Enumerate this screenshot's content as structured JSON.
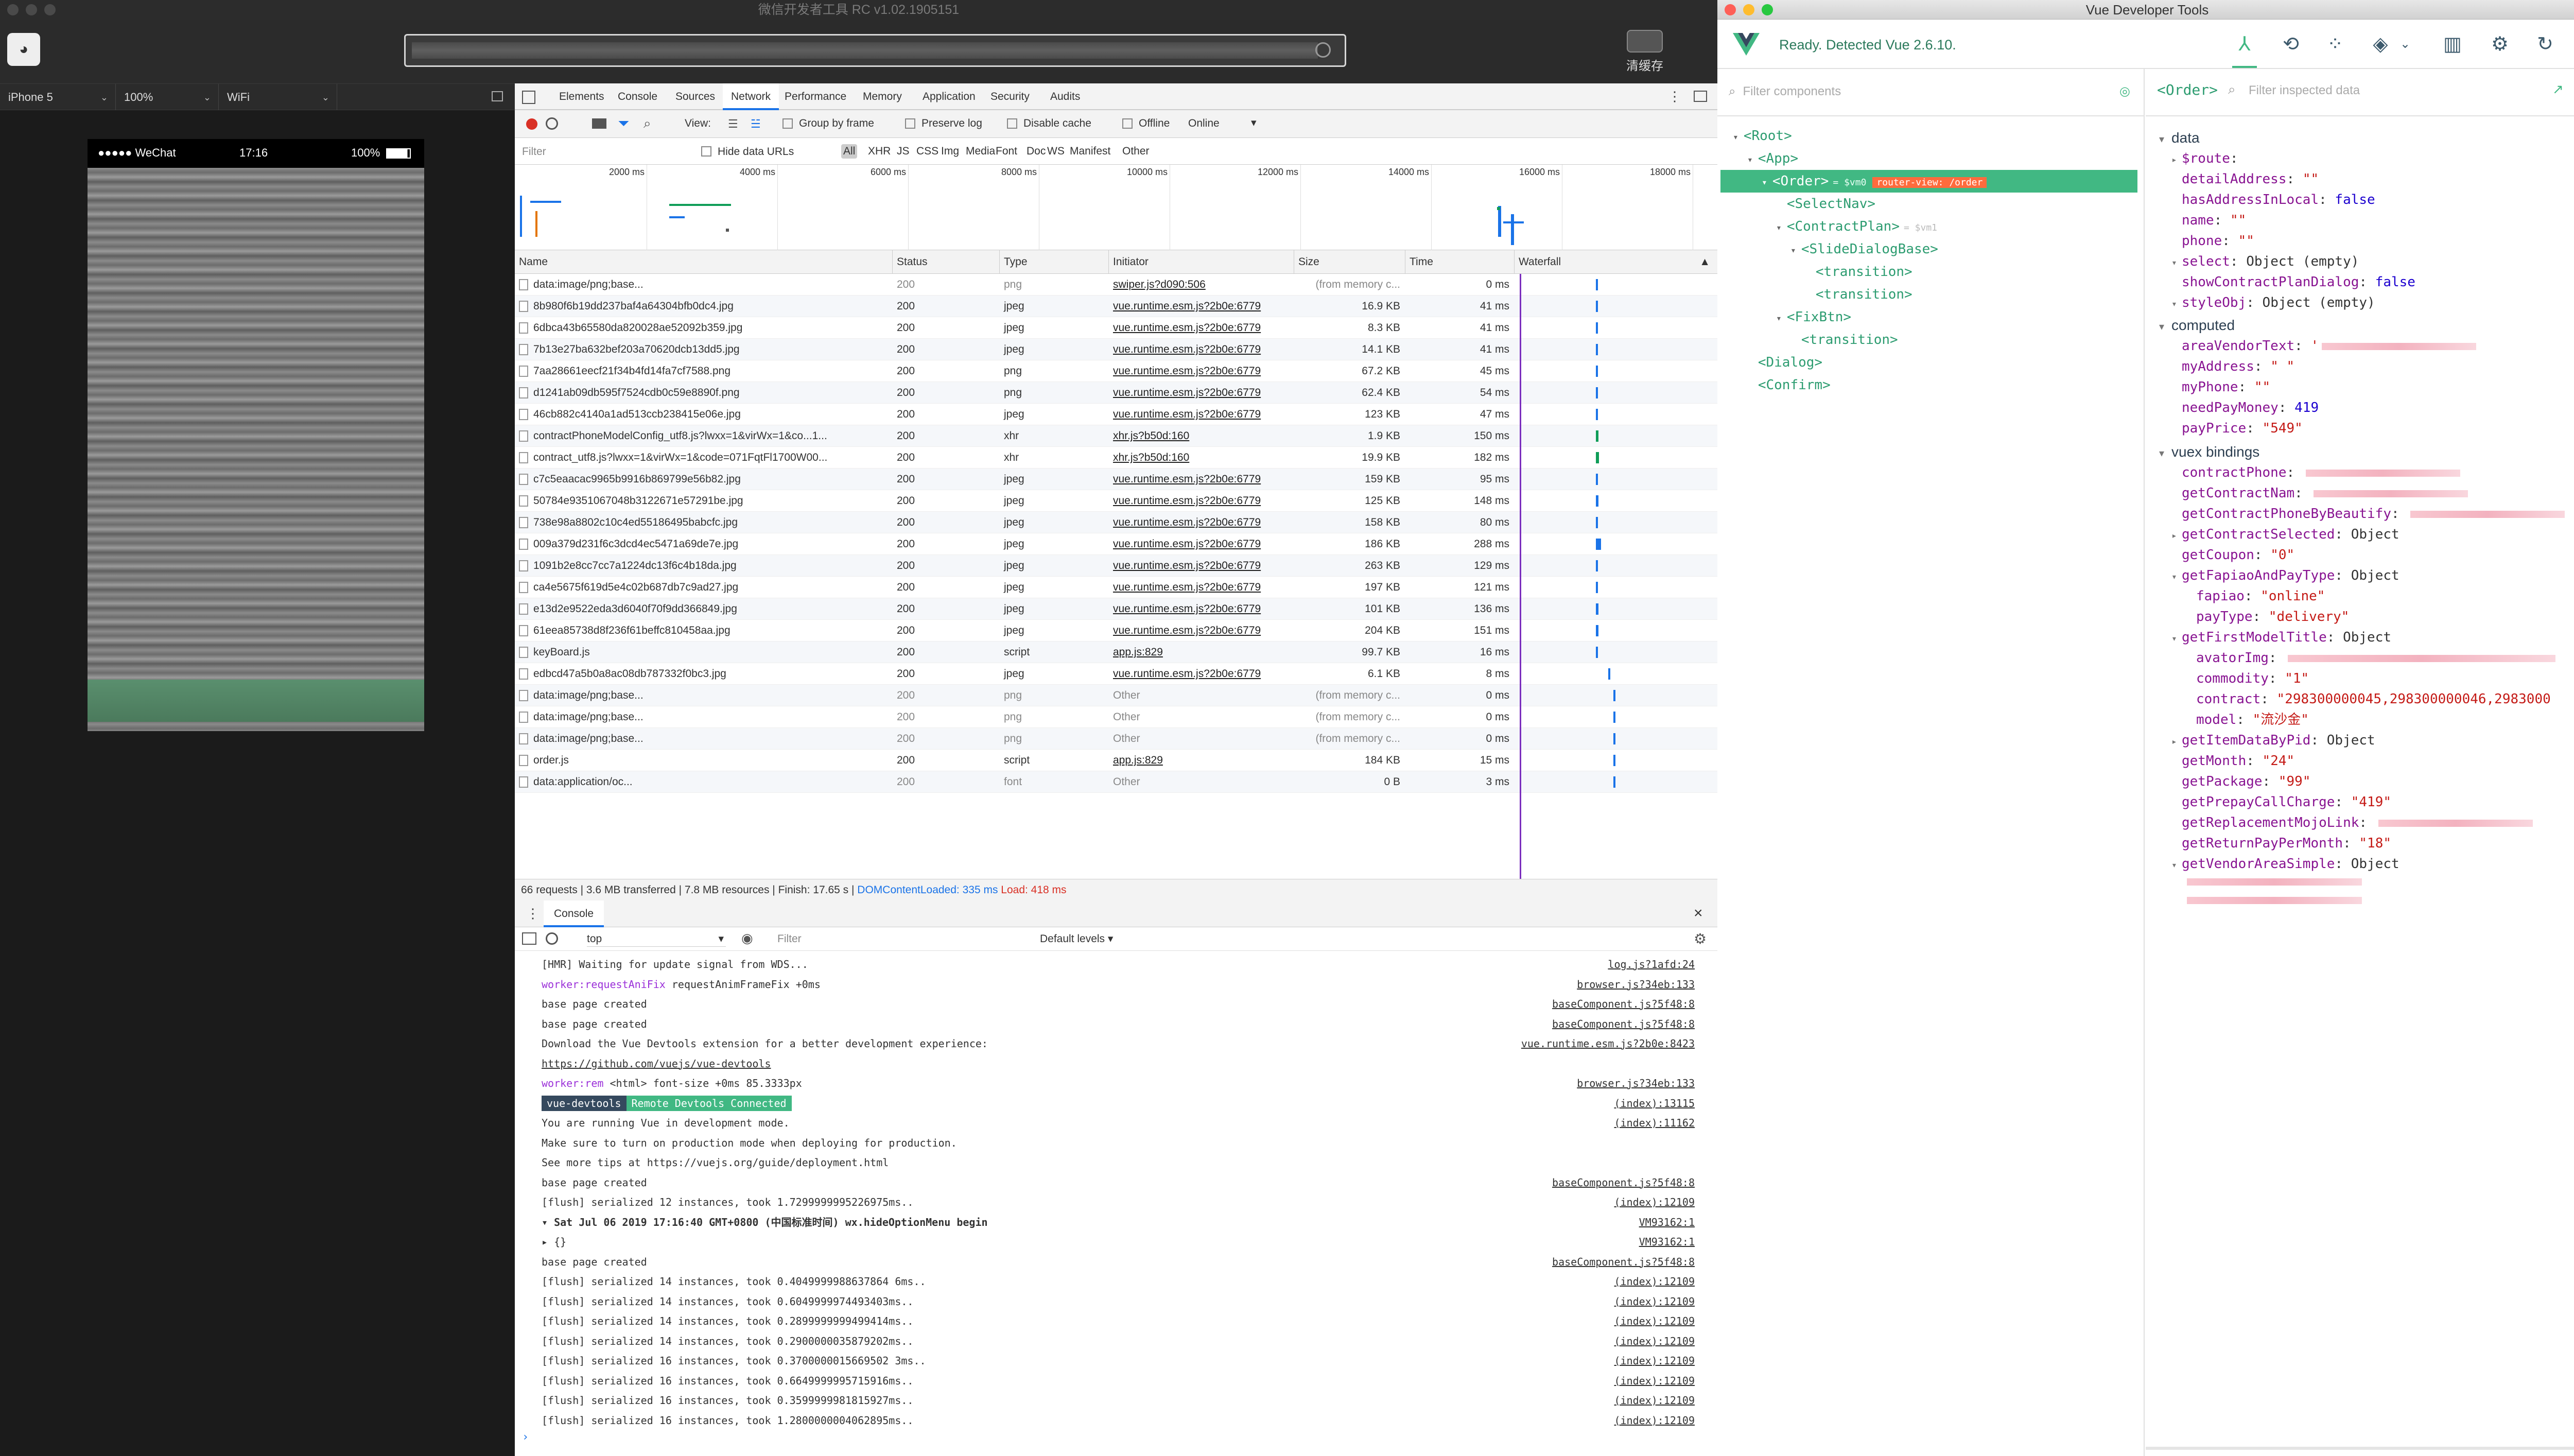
{
  "wechat": {
    "title": "微信开发者工具 RC v1.02.1905151",
    "clear_cache_label": "清缓存",
    "device": "iPhone 5",
    "zoom": "100%",
    "network": "WiFi",
    "phone_carrier": "●●●●● WeChat",
    "phone_time": "17:16",
    "phone_battery": "100%"
  },
  "devtools": {
    "tabs": [
      "Elements",
      "Console",
      "Sources",
      "Network",
      "Performance",
      "Memory",
      "Application",
      "Security",
      "Audits"
    ],
    "selected_tab": "Network",
    "toolbar": {
      "view_label": "View:",
      "group_by_frame": "Group by frame",
      "preserve_log": "Preserve log",
      "disable_cache": "Disable cache",
      "offline": "Offline",
      "online": "Online"
    },
    "filter": {
      "placeholder": "Filter",
      "hide_data_urls": "Hide data URLs",
      "types": [
        "All",
        "XHR",
        "JS",
        "CSS",
        "Img",
        "Media",
        "Font",
        "Doc",
        "WS",
        "Manifest",
        "Other"
      ]
    },
    "overview_ticks": [
      "2000 ms",
      "4000 ms",
      "6000 ms",
      "8000 ms",
      "10000 ms",
      "12000 ms",
      "14000 ms",
      "16000 ms",
      "18000 ms"
    ],
    "columns": [
      "Name",
      "Status",
      "Type",
      "Initiator",
      "Size",
      "Time",
      "Waterfall"
    ],
    "requests": [
      [
        "data:image/png;base...",
        "200",
        "png",
        "swiper.js?d090:506",
        "(from memory c...",
        "0 ms"
      ],
      [
        "8b980f6b19dd237baf4a64304bfb0dc4.jpg",
        "200",
        "jpeg",
        "vue.runtime.esm.js?2b0e:6779",
        "16.9 KB",
        "41 ms"
      ],
      [
        "6dbca43b65580da820028ae52092b359.jpg",
        "200",
        "jpeg",
        "vue.runtime.esm.js?2b0e:6779",
        "8.3 KB",
        "41 ms"
      ],
      [
        "7b13e27ba632bef203a70620dcb13dd5.jpg",
        "200",
        "jpeg",
        "vue.runtime.esm.js?2b0e:6779",
        "14.1 KB",
        "41 ms"
      ],
      [
        "7aa28661eecf21f34b4fd14fa7cf7588.png",
        "200",
        "png",
        "vue.runtime.esm.js?2b0e:6779",
        "67.2 KB",
        "45 ms"
      ],
      [
        "d1241ab09db595f7524cdb0c59e8890f.png",
        "200",
        "png",
        "vue.runtime.esm.js?2b0e:6779",
        "62.4 KB",
        "54 ms"
      ],
      [
        "46cb882c4140a1ad513ccb238415e06e.jpg",
        "200",
        "jpeg",
        "vue.runtime.esm.js?2b0e:6779",
        "123 KB",
        "47 ms"
      ],
      [
        "contractPhoneModelConfig_utf8.js?lwxx=1&virWx=1&co...1...",
        "200",
        "xhr",
        "xhr.js?b50d:160",
        "1.9 KB",
        "150 ms"
      ],
      [
        "contract_utf8.js?lwxx=1&virWx=1&code=071FqtFl1700W00...",
        "200",
        "xhr",
        "xhr.js?b50d:160",
        "19.9 KB",
        "182 ms"
      ],
      [
        "c7c5eaacac9965b9916b869799e56b82.jpg",
        "200",
        "jpeg",
        "vue.runtime.esm.js?2b0e:6779",
        "159 KB",
        "95 ms"
      ],
      [
        "50784e9351067048b3122671e57291be.jpg",
        "200",
        "jpeg",
        "vue.runtime.esm.js?2b0e:6779",
        "125 KB",
        "148 ms"
      ],
      [
        "738e98a8802c10c4ed55186495babcfc.jpg",
        "200",
        "jpeg",
        "vue.runtime.esm.js?2b0e:6779",
        "158 KB",
        "80 ms"
      ],
      [
        "009a379d231f6c3dcd4ec5471a69de7e.jpg",
        "200",
        "jpeg",
        "vue.runtime.esm.js?2b0e:6779",
        "186 KB",
        "288 ms"
      ],
      [
        "1091b2e8cc7cc7a1224dc13f6c4b18da.jpg",
        "200",
        "jpeg",
        "vue.runtime.esm.js?2b0e:6779",
        "263 KB",
        "129 ms"
      ],
      [
        "ca4e5675f619d5e4c02b687db7c9ad27.jpg",
        "200",
        "jpeg",
        "vue.runtime.esm.js?2b0e:6779",
        "197 KB",
        "121 ms"
      ],
      [
        "e13d2e9522eda3d6040f70f9dd366849.jpg",
        "200",
        "jpeg",
        "vue.runtime.esm.js?2b0e:6779",
        "101 KB",
        "136 ms"
      ],
      [
        "61eea85738d8f236f61beffc810458aa.jpg",
        "200",
        "jpeg",
        "vue.runtime.esm.js?2b0e:6779",
        "204 KB",
        "151 ms"
      ],
      [
        "keyBoard.js",
        "200",
        "script",
        "app.js:829",
        "99.7 KB",
        "16 ms"
      ],
      [
        "edbcd47a5b0a8ac08db787332f0bc3.jpg",
        "200",
        "jpeg",
        "vue.runtime.esm.js?2b0e:6779",
        "6.1 KB",
        "8 ms"
      ],
      [
        "data:image/png;base...",
        "200",
        "png",
        "Other",
        "(from memory c...",
        "0 ms"
      ],
      [
        "data:image/png;base...",
        "200",
        "png",
        "Other",
        "(from memory c...",
        "0 ms"
      ],
      [
        "data:image/png;base...",
        "200",
        "png",
        "Other",
        "(from memory c...",
        "0 ms"
      ],
      [
        "order.js",
        "200",
        "script",
        "app.js:829",
        "184 KB",
        "15 ms"
      ],
      [
        "data:application/oc...",
        "200",
        "font",
        "Other",
        "0 B",
        "3 ms"
      ]
    ],
    "summary": {
      "main": "66 requests | 3.6 MB transferred | 7.8 MB resources | Finish: 17.65 s |",
      "dcl": "DOMContentLoaded: 335 ms",
      "load": "Load: 418 ms"
    },
    "console": {
      "tab": "Console",
      "context": "top",
      "filter_placeholder": "Filter",
      "levels": "Default levels ▾",
      "lines": [
        {
          "text": "[HMR] Waiting for update signal from WDS...",
          "src": "log.js?1afd:24"
        },
        {
          "pre": "worker:requestAniFix",
          "text": " requestAnimFrameFix +0ms",
          "src": "browser.js?34eb:133"
        },
        {
          "text": "base page created",
          "src": "baseComponent.js?5f48:8"
        },
        {
          "text": "base page created",
          "src": "baseComponent.js?5f48:8"
        },
        {
          "text": "Download the Vue Devtools extension for a better development experience:",
          "src": "vue.runtime.esm.js?2b0e:8423"
        },
        {
          "text": "https://github.com/vuejs/vue-devtools",
          "src": ""
        },
        {
          "pre": "worker:rem",
          "text": " <html> font-size +0ms 85.3333px",
          "src": "browser.js?34eb:133"
        },
        {
          "badge1": "vue-devtools",
          "badge2": "Remote Devtools Connected",
          "src": "(index):13115"
        },
        {
          "text": "You are running Vue in development mode.",
          "src": "(index):11162"
        },
        {
          "text": "Make sure to turn on production mode when deploying for production.",
          "src": ""
        },
        {
          "text": "See more tips at https://vuejs.org/guide/deployment.html",
          "src": ""
        },
        {
          "text": "base page created",
          "src": "baseComponent.js?5f48:8"
        },
        {
          "text": "[flush] serialized 12 instances, took 1.7299999995226975ms..",
          "src": "(index):12109"
        },
        {
          "text": "▾ Sat Jul 06 2019 17:16:40 GMT+0800 (中国标准时间) wx.hideOptionMenu begin",
          "src": "VM93162:1"
        },
        {
          "text": "  ▸ {}",
          "src": "VM93162:1"
        },
        {
          "text": "base page created",
          "src": "baseComponent.js?5f48:8"
        },
        {
          "text": "[flush] serialized 14 instances, took 0.4049999988637864 6ms..",
          "src": "(index):12109"
        },
        {
          "text": "[flush] serialized 14 instances, took 0.6049999974493403ms..",
          "src": "(index):12109"
        },
        {
          "text": "[flush] serialized 14 instances, took 0.2899999999499414ms..",
          "src": "(index):12109"
        },
        {
          "text": "[flush] serialized 14 instances, took 0.2900000035879202ms..",
          "src": "(index):12109"
        },
        {
          "text": "[flush] serialized 16 instances, took 0.3700000015669502 3ms..",
          "src": "(index):12109"
        },
        {
          "text": "[flush] serialized 16 instances, took 0.6649999995715916ms..",
          "src": "(index):12109"
        },
        {
          "text": "[flush] serialized 16 instances, took 0.3599999981815927ms..",
          "src": "(index):12109"
        },
        {
          "text": "[flush] serialized 16 instances, took 1.2800000004062895ms..",
          "src": "(index):12109"
        }
      ]
    }
  },
  "vue": {
    "title": "Vue Developer Tools",
    "ready": "Ready. Detected Vue 2.6.10.",
    "components_filter": "Filter components",
    "selected_component": "<Order>",
    "inspect_filter": "Filter inspected data",
    "tree": [
      {
        "label": "<Root>",
        "depth": 0,
        "arrow": "▾"
      },
      {
        "label": "<App>",
        "depth": 1,
        "arrow": "▾"
      },
      {
        "label": "<Order>",
        "depth": 2,
        "arrow": "▾",
        "selected": true,
        "extra": "= $vm0",
        "route": "router-view: /order"
      },
      {
        "label": "<SelectNav>",
        "depth": 3,
        "arrow": ""
      },
      {
        "label": "<ContractPlan>",
        "depth": 3,
        "arrow": "▾",
        "extra": "= $vm1"
      },
      {
        "label": "<SlideDialogBase>",
        "depth": 4,
        "arrow": "▾"
      },
      {
        "label": "<transition>",
        "depth": 5,
        "arrow": ""
      },
      {
        "label": "<transition>",
        "depth": 5,
        "arrow": ""
      },
      {
        "label": "<FixBtn>",
        "depth": 3,
        "arrow": "▾"
      },
      {
        "label": "<transition>",
        "depth": 4,
        "arrow": ""
      },
      {
        "label": "<Dialog>",
        "depth": 1,
        "arrow": ""
      },
      {
        "label": "<Confirm>",
        "depth": 1,
        "arrow": ""
      }
    ],
    "sections": {
      "data": "data",
      "computed": "computed",
      "vuex": "vuex bindings"
    },
    "data_items": [
      {
        "k": "$route",
        "v": "",
        "t": "obj",
        "arrow": "▸"
      },
      {
        "k": "detailAddress",
        "v": "\"\"",
        "t": "str"
      },
      {
        "k": "hasAddressInLocal",
        "v": "false",
        "t": "bool"
      },
      {
        "k": "name",
        "v": "\"\"",
        "t": "str"
      },
      {
        "k": "phone",
        "v": "\"\"",
        "t": "str"
      },
      {
        "k": "select",
        "v": "Object (empty)",
        "t": "obj",
        "arrow": "▾"
      },
      {
        "k": "showContractPlanDialog",
        "v": "false",
        "t": "bool"
      },
      {
        "k": "styleObj",
        "v": "Object (empty)",
        "t": "obj",
        "arrow": "▾"
      }
    ],
    "computed_items": [
      {
        "k": "areaVendorText",
        "v": "'",
        "t": "str",
        "redact": true
      },
      {
        "k": "myAddress",
        "v": "\" \"",
        "t": "str"
      },
      {
        "k": "myPhone",
        "v": "\"\"",
        "t": "str"
      },
      {
        "k": "needPayMoney",
        "v": "419",
        "t": "num"
      },
      {
        "k": "payPrice",
        "v": "\"549\"",
        "t": "str"
      }
    ],
    "vuex_items": [
      {
        "k": "contractPhone",
        "v": "",
        "t": "str",
        "redact": true,
        "d": 0
      },
      {
        "k": "getContractNam",
        "v": "",
        "t": "str",
        "redact": true,
        "d": 0
      },
      {
        "k": "getContractPhoneByBeautify",
        "v": "",
        "t": "str",
        "redact": true,
        "d": 0
      },
      {
        "k": "getContractSelected",
        "v": "Object",
        "t": "obj",
        "arrow": "▸",
        "d": 0
      },
      {
        "k": "getCoupon",
        "v": "\"0\"",
        "t": "str",
        "d": 0
      },
      {
        "k": "getFapiaoAndPayType",
        "v": "Object",
        "t": "obj",
        "arrow": "▾",
        "d": 0
      },
      {
        "k": "fapiao",
        "v": "\"online\"",
        "t": "str",
        "d": 1
      },
      {
        "k": "payType",
        "v": "\"delivery\"",
        "t": "str",
        "d": 1
      },
      {
        "k": "getFirstModelTitle",
        "v": "Object",
        "t": "obj",
        "arrow": "▾",
        "d": 0
      },
      {
        "k": "avatorImg",
        "v": "",
        "t": "str",
        "redact": true,
        "d": 1
      },
      {
        "k": "commodity",
        "v": "\"1\"",
        "t": "str",
        "d": 1
      },
      {
        "k": "contract",
        "v": "\"298300000045,298300000046,2983000",
        "t": "str",
        "d": 1
      },
      {
        "k": "model",
        "v": "\"流沙金\"",
        "t": "str",
        "d": 1
      },
      {
        "k": "getItemDataByPid",
        "v": "Object",
        "t": "obj",
        "arrow": "▸",
        "d": 0
      },
      {
        "k": "getMonth",
        "v": "\"24\"",
        "t": "str",
        "d": 0
      },
      {
        "k": "getPackage",
        "v": "\"99\"",
        "t": "str",
        "d": 0
      },
      {
        "k": "getPrepayCallCharge",
        "v": "\"419\"",
        "t": "str",
        "d": 0
      },
      {
        "k": "getReplacementMojoLink",
        "v": "",
        "t": "str",
        "redact": true,
        "d": 0
      },
      {
        "k": "getReturnPayPerMonth",
        "v": "\"18\"",
        "t": "str",
        "d": 0
      },
      {
        "k": "getVendorAreaSimple",
        "v": "Object",
        "t": "obj",
        "arrow": "▾",
        "d": 0
      }
    ]
  }
}
